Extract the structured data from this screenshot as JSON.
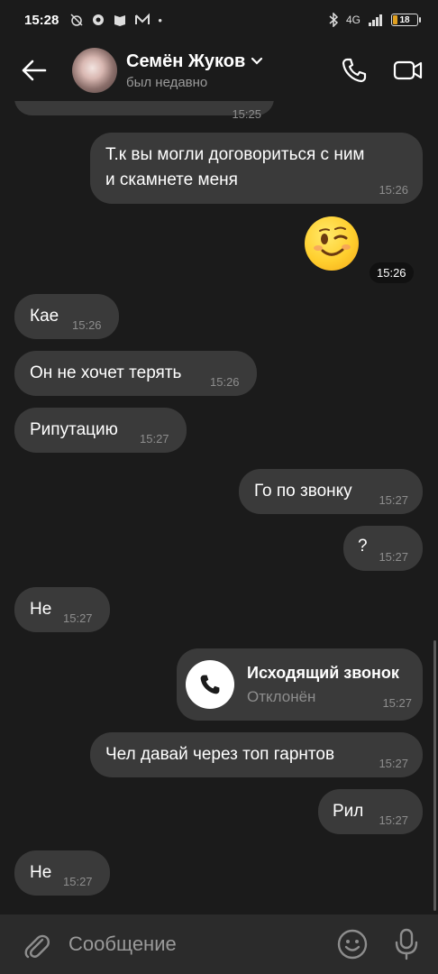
{
  "status_bar": {
    "time": "15:28",
    "network": "4G",
    "battery": "18"
  },
  "header": {
    "contact_name": "Семён Жуков",
    "contact_status": "был недавно"
  },
  "messages": [
    {
      "direction": "in",
      "text": "",
      "time": "15:25",
      "partial": true
    },
    {
      "direction": "out",
      "text_lines": [
        "Т.к вы могли договориться с ним",
        "и скамнете меня"
      ],
      "time": "15:26"
    },
    {
      "direction": "out",
      "type": "emoji",
      "emoji": "wink-emoji",
      "time": "15:26"
    },
    {
      "direction": "in",
      "text": "Кае",
      "time": "15:26"
    },
    {
      "direction": "in",
      "text": "Он не хочет терять",
      "time": "15:26"
    },
    {
      "direction": "in",
      "text": "Рипутацию",
      "time": "15:27"
    },
    {
      "direction": "out",
      "text": "Го по звонку",
      "time": "15:27"
    },
    {
      "direction": "out",
      "text": "?",
      "time": "15:27"
    },
    {
      "direction": "in",
      "text": "Не",
      "time": "15:27"
    },
    {
      "direction": "out",
      "type": "call",
      "title": "Исходящий звонок",
      "subtitle": "Отклонён",
      "time": "15:27"
    },
    {
      "direction": "out",
      "text": "Чел давай через топ гарнтов",
      "time": "15:27"
    },
    {
      "direction": "out",
      "text": "Рил",
      "time": "15:27"
    },
    {
      "direction": "in",
      "text": "Не",
      "time": "15:27"
    }
  ],
  "composer": {
    "placeholder": "Сообщение"
  },
  "colors": {
    "background": "#1b1b1b",
    "bubble": "#3a3a3a",
    "composer": "#2b2b2b",
    "time_text": "#8d8d8d"
  }
}
